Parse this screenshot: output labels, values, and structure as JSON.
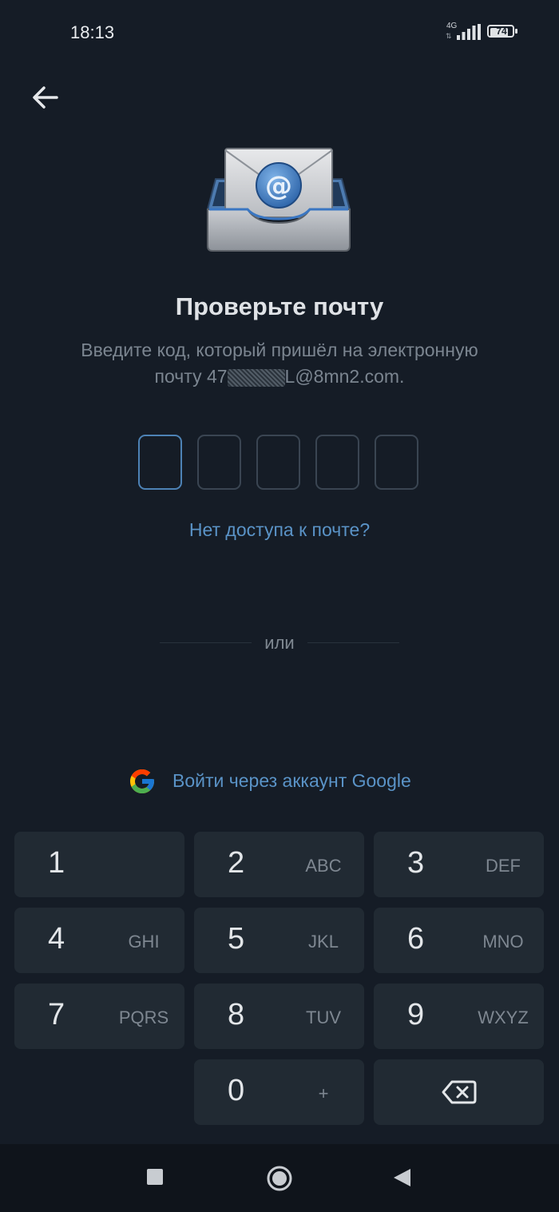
{
  "status_bar": {
    "time": "18:13",
    "network": "4G",
    "battery": "74"
  },
  "header": {
    "back_icon": "arrow-left-icon"
  },
  "illustration": {
    "icon": "email-inbox-icon"
  },
  "main": {
    "title": "Проверьте почту",
    "subtitle_line1": "Введите код, который пришёл на электронную",
    "subtitle_line2_prefix": "почту 47",
    "subtitle_line2_suffix": "L@8mn2.com.",
    "code_length": 5,
    "no_access_link": "Нет доступа к почте?",
    "or_label": "или",
    "google_label": "Войти через аккаунт Google"
  },
  "keypad": {
    "keys": [
      {
        "digit": "1",
        "letters": ""
      },
      {
        "digit": "2",
        "letters": "ABC"
      },
      {
        "digit": "3",
        "letters": "DEF"
      },
      {
        "digit": "4",
        "letters": "GHI"
      },
      {
        "digit": "5",
        "letters": "JKL"
      },
      {
        "digit": "6",
        "letters": "MNO"
      },
      {
        "digit": "7",
        "letters": "PQRS"
      },
      {
        "digit": "8",
        "letters": "TUV"
      },
      {
        "digit": "9",
        "letters": "WXYZ"
      },
      {
        "digit": "0",
        "letters": "+"
      }
    ],
    "backspace_icon": "backspace-icon"
  },
  "nav_bar": {
    "icons": [
      "recent-apps-icon",
      "home-icon",
      "back-triangle-icon"
    ]
  },
  "colors": {
    "background": "#151c26",
    "accent": "#5a93c7",
    "key_background": "#212a33"
  }
}
